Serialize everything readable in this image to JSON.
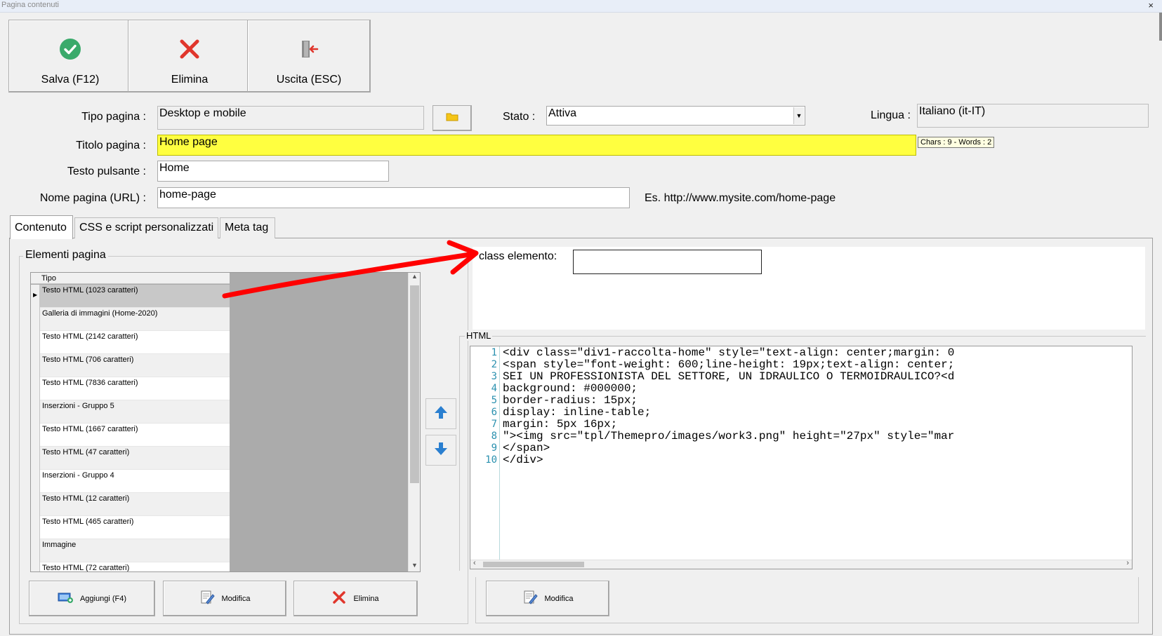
{
  "window": {
    "title": "Pagina contenuti",
    "close": "×"
  },
  "toolbar": {
    "save_label": "Salva (F12)",
    "delete_label": "Elimina",
    "exit_label": "Uscita (ESC)"
  },
  "form": {
    "tipo_pagina_label": "Tipo pagina :",
    "tipo_pagina_value": "Desktop e mobile",
    "stato_label": "Stato :",
    "stato_value": "Attiva",
    "lingua_label": "Lingua :",
    "lingua_value": "Italiano (it-IT)",
    "titolo_label": "Titolo pagina :",
    "titolo_value": "Home page",
    "titolo_counter": "Chars : 9 - Words : 2",
    "testo_pulsante_label": "Testo pulsante :",
    "testo_pulsante_value": "Home",
    "nome_pagina_label": "Nome pagina (URL) :",
    "nome_pagina_value": "home-page",
    "url_example": "Es. http://www.mysite.com/home-page"
  },
  "tabs": [
    {
      "label": "Contenuto"
    },
    {
      "label": "CSS e script personalizzati"
    },
    {
      "label": "Meta tag"
    }
  ],
  "elements_group": {
    "title": "Elementi pagina",
    "column_header": "Tipo",
    "rows": [
      "Testo HTML (1023 caratteri)",
      "Galleria di immagini (Home-2020)",
      "Testo HTML (2142 caratteri)",
      "Testo HTML (706 caratteri)",
      "Testo HTML (7836 caratteri)",
      "Inserzioni - Gruppo 5",
      "Testo HTML (1667 caratteri)",
      "Testo HTML (47 caratteri)",
      "Inserzioni - Gruppo 4",
      "Testo HTML (12 caratteri)",
      "Testo HTML (465 caratteri)",
      "Immagine",
      "Testo HTML (72 caratteri)"
    ],
    "add_label": "Aggiungi (F4)",
    "edit_label": "Modifica",
    "delete_label": "Elimina"
  },
  "detail": {
    "class_label": "class elemento:",
    "class_value": "",
    "html_legend": "HTML",
    "code_lines": [
      "<div class=\"div1-raccolta-home\" style=\"text-align: center;margin: 0",
      "<span style=\"font-weight: 600;line-height: 19px;text-align: center;",
      "SEI UN PROFESSIONISTA DEL SETTORE, UN IDRAULICO O TERMOIDRAULICO?<d",
      "background: #000000;",
      "border-radius: 15px;",
      "display: inline-table;",
      "margin: 5px 16px;",
      "\"><img src=\"tpl/Themepro/images/work3.png\" height=\"27px\" style=\"mar",
      "</span>",
      "</div>"
    ],
    "line_numbers": [
      "1",
      "2",
      "3",
      "4",
      "5",
      "6",
      "7",
      "8",
      "9",
      "10"
    ],
    "edit_label": "Modifica"
  },
  "colors": {
    "title_field_bg": "#ffff40",
    "annotation_arrow": "#ff0000",
    "save_icon": "#3aaa6b",
    "delete_icon": "#e0362c",
    "arrow_icon": "#2a7fd0"
  }
}
